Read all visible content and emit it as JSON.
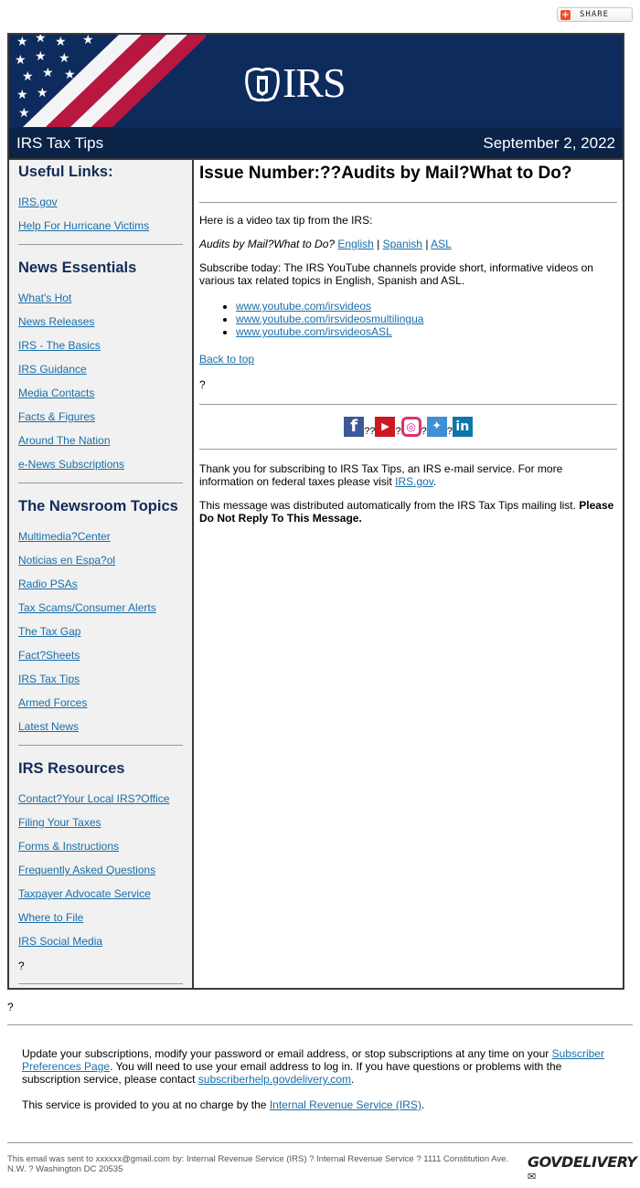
{
  "share": {
    "label": "SHARE"
  },
  "header": {
    "logo_text": "IRS",
    "title": "IRS Tax Tips",
    "date": "September 2, 2022",
    "colors": {
      "navy": "#0e2b5e",
      "titlebar": "#0a2347",
      "red": "#b8173f"
    }
  },
  "sidebar": {
    "sections": [
      {
        "heading": "Useful Links:",
        "links": [
          "IRS.gov",
          "Help For Hurricane Victims"
        ]
      },
      {
        "heading": "News Essentials",
        "links": [
          "What's Hot",
          "News Releases",
          "IRS - The Basics",
          "IRS Guidance",
          "Media Contacts",
          "Facts & Figures",
          "Around The Nation",
          "e-News Subscriptions"
        ]
      },
      {
        "heading": "The Newsroom Topics",
        "links": [
          "Multimedia?Center",
          "Noticias en Espa?ol",
          "Radio PSAs",
          "Tax Scams/Consumer Alerts",
          "The Tax Gap",
          "Fact?Sheets",
          "IRS Tax Tips",
          "Armed Forces",
          "Latest News"
        ]
      },
      {
        "heading": "IRS Resources",
        "links": [
          "Contact?Your Local IRS?Office",
          "Filing Your Taxes",
          "Forms & Instructions",
          "Frequently Asked Questions",
          "Taxpayer Advocate Service",
          "Where to File",
          "IRS Social Media"
        ]
      }
    ],
    "trailing_text": "?"
  },
  "main": {
    "title": "Issue Number:??Audits by Mail?What to Do?",
    "intro": "Here is a video tax tip from the IRS:",
    "video_title": "Audits by Mail?What to Do?",
    "video_links": [
      "English",
      "Spanish",
      "ASL"
    ],
    "separator": "|",
    "subscribe_text": "Subscribe today: The IRS YouTube channels provide short, informative videos on various tax related topics in English, Spanish and ASL.",
    "youtube_links": [
      "www.youtube.com/irsvideos",
      "www.youtube.com/irsvideosmultilingua",
      "www.youtube.com/irsvideosASL"
    ],
    "back_to_top": "Back to top",
    "stray": "?",
    "social": [
      {
        "icon": "facebook-icon",
        "glyph": "f",
        "color": "#3b5998",
        "after": "??"
      },
      {
        "icon": "youtube-icon",
        "glyph": "▶",
        "color": "#cc181e",
        "after": "?"
      },
      {
        "icon": "instagram-icon",
        "glyph": "◎",
        "color": "#d6249f",
        "after": "?"
      },
      {
        "icon": "twitter-icon",
        "glyph": "🐦",
        "color": "#3f8fd6",
        "after": "?"
      },
      {
        "icon": "linkedin-icon",
        "glyph": "in",
        "color": "#0e76a8",
        "after": ""
      }
    ],
    "thanks_prefix": "Thank you for subscribing to IRS Tax Tips, an IRS e-mail service. For more information on federal taxes please visit ",
    "thanks_link": "IRS.gov",
    "thanks_suffix": ".",
    "distributed_text": "This message was distributed automatically from the IRS Tax Tips mailing list. ",
    "distributed_bold": "Please Do Not Reply To This Message."
  },
  "after_box": "?",
  "footer": {
    "update_prefix": "Update your subscriptions, modify your password or email address, or stop subscriptions at any time on your ",
    "prefs_link": "Subscriber Preferences Page",
    "update_mid": ". You will need to use your email address to log in. If you have questions or problems with the subscription service, please contact ",
    "help_link": "subscriberhelp.govdelivery.com",
    "update_suffix": ".",
    "service_prefix": "This service is provided to you at no charge by the ",
    "service_link": "Internal Revenue Service (IRS)",
    "service_suffix": ".",
    "sent_text": "This email was sent to xxxxxx@gmail.com by: Internal Revenue Service (IRS) ? Internal Revenue Service ? 1111 Constitution Ave. N.W. ? Washington DC 20535",
    "brand": "GOVDELIVERY"
  }
}
